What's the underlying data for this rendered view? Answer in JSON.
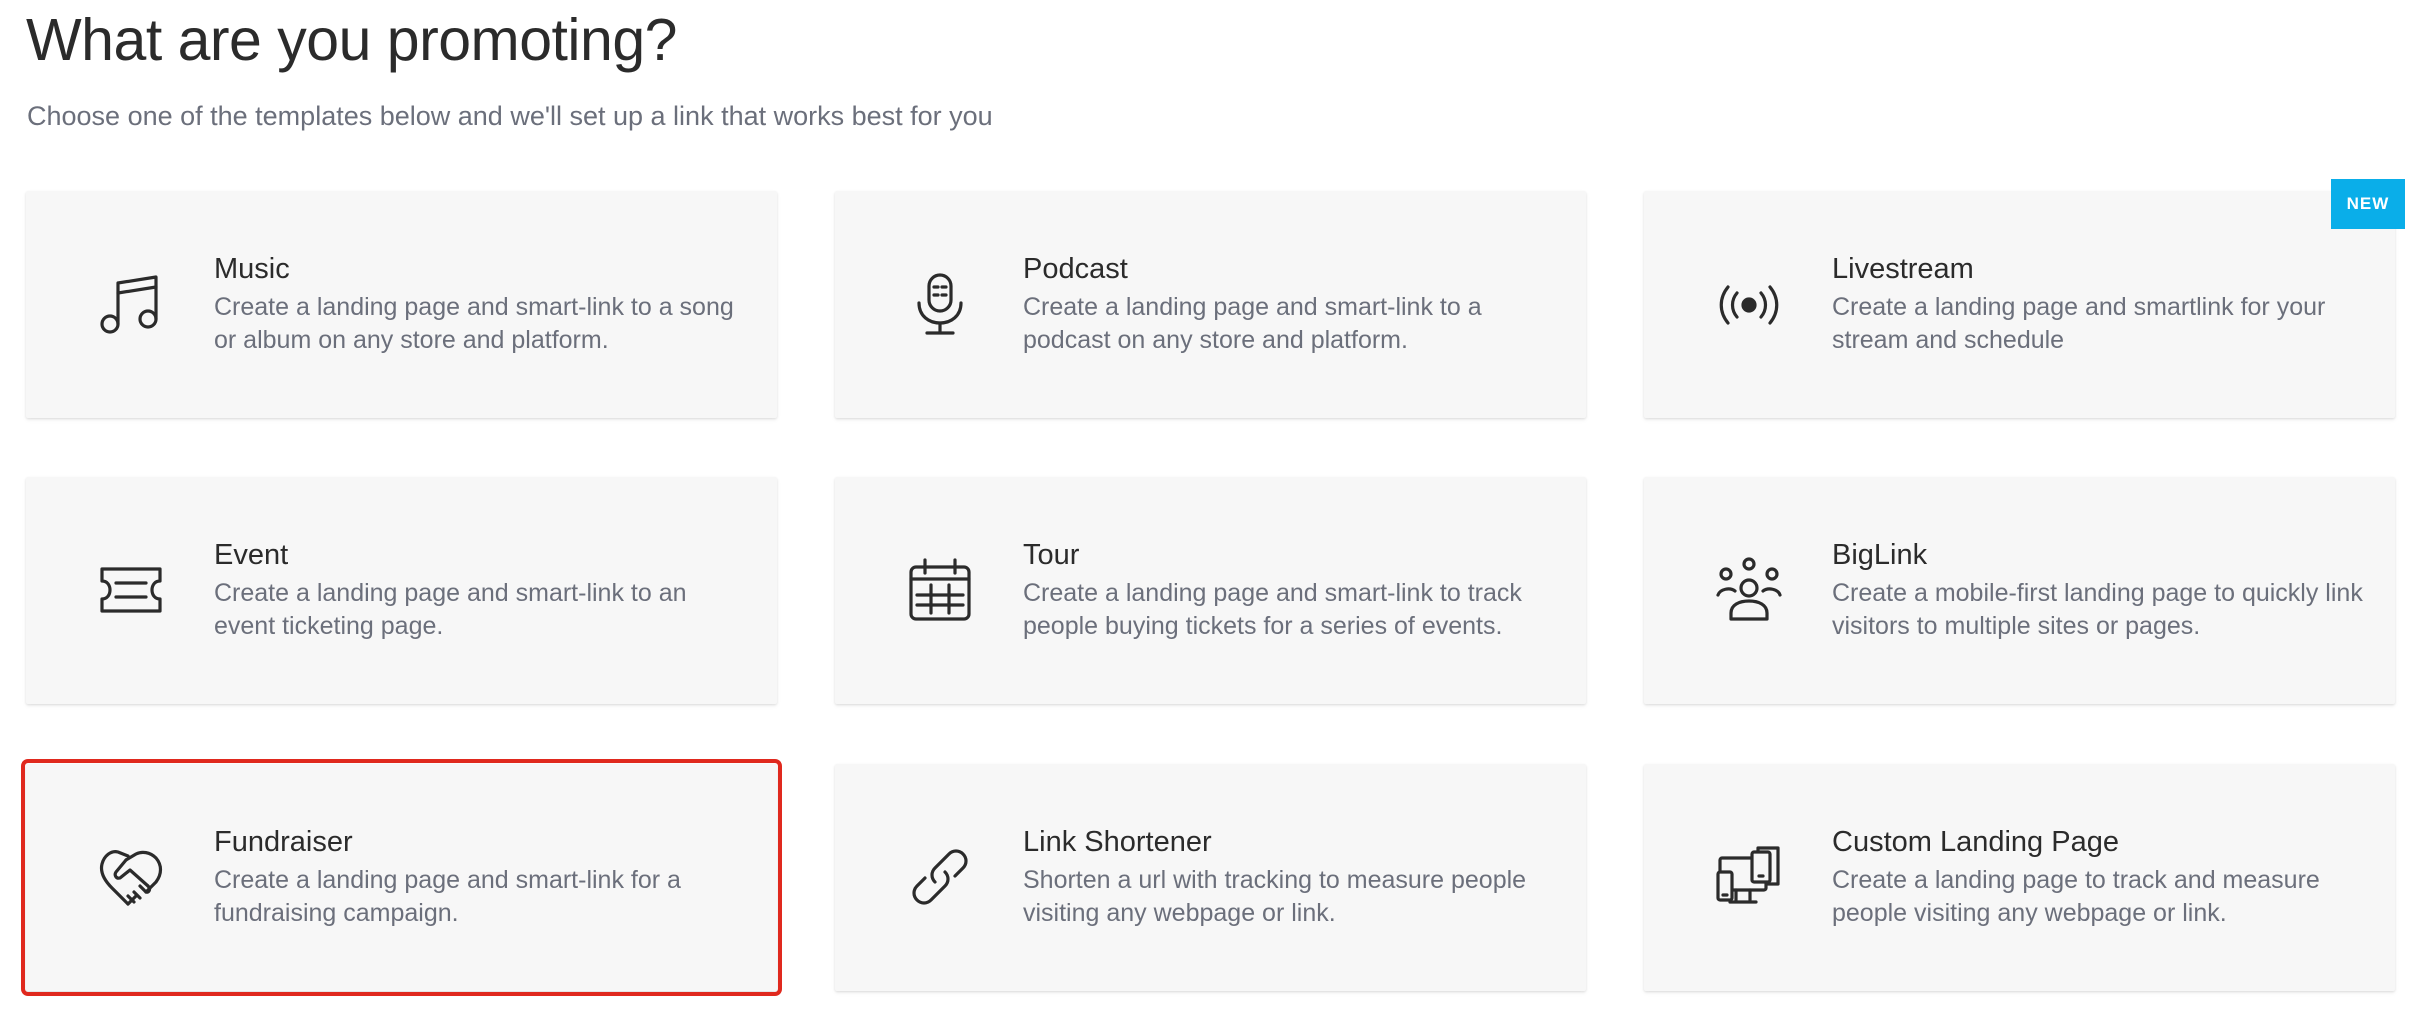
{
  "header": {
    "title": "What are you promoting?",
    "subtitle": "Choose one of the templates below and we'll set up a link that works best for you"
  },
  "templates": [
    {
      "title": "Music",
      "description": "Create a landing page and smart-link to a song or album on any store and platform.",
      "icon": "music-note-icon"
    },
    {
      "title": "Podcast",
      "description": "Create a landing page and smart-link to a podcast on any store and platform.",
      "icon": "microphone-icon"
    },
    {
      "title": "Livestream",
      "description": "Create a landing page and smartlink for your stream and schedule",
      "icon": "broadcast-icon",
      "badge": "NEW"
    },
    {
      "title": "Event",
      "description": "Create a landing page and smart-link to an event ticketing page.",
      "icon": "ticket-icon"
    },
    {
      "title": "Tour",
      "description": "Create a landing page and smart-link to track people buying tickets for a series of events.",
      "icon": "calendar-icon"
    },
    {
      "title": "BigLink",
      "description": "Create a mobile-first landing page to quickly link visitors to multiple sites or pages.",
      "icon": "people-group-icon"
    },
    {
      "title": "Fundraiser",
      "description": "Create a landing page and smart-link for a fundraising campaign.",
      "icon": "handshake-icon",
      "selected": true
    },
    {
      "title": "Link Shortener",
      "description": "Shorten a url with tracking to measure people visiting any webpage or link.",
      "icon": "chain-link-icon"
    },
    {
      "title": "Custom Landing Page",
      "description": "Create a landing page to track and measure people visiting any webpage or link.",
      "icon": "devices-icon"
    }
  ],
  "colors": {
    "selected_outline": "#e0291e",
    "badge_background": "#0aaee9",
    "card_background": "#f7f7f7"
  }
}
